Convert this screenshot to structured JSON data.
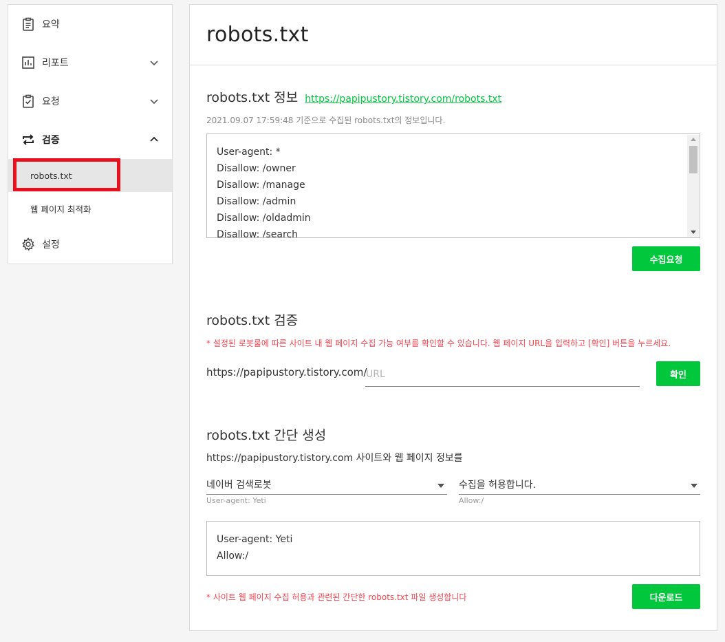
{
  "sidebar": {
    "items": [
      {
        "label": "요약",
        "icon": "clipboard-list-icon"
      },
      {
        "label": "리포트",
        "icon": "bar-chart-icon"
      },
      {
        "label": "요청",
        "icon": "clipboard-check-icon"
      },
      {
        "label": "검증",
        "icon": "swap-arrows-icon"
      },
      {
        "label": "설정",
        "icon": "gear-icon"
      }
    ],
    "sub_items": [
      {
        "label": "robots.txt",
        "active": true
      },
      {
        "label": "웹 페이지 최적화",
        "active": false
      }
    ]
  },
  "main": {
    "title": "robots.txt",
    "info_section": {
      "title": "robots.txt 정보",
      "link": "https://papipustory.tistory.com/robots.txt",
      "desc": "2021.09.07 17:59:48 기준으로 수집된 robots.txt의 정보입니다.",
      "lines": [
        "User-agent: *",
        "Disallow: /owner",
        "Disallow: /manage",
        "Disallow: /admin",
        "Disallow: /oldadmin",
        "Disallow: /search"
      ],
      "button": "수집요청"
    },
    "verify_section": {
      "title": "robots.txt 검증",
      "warning": "* 설정된 로봇룰에 따른 사이트 내 웹 페이지 수집 가능 여부를 확인할 수 있습니다. 웹 페이지 URL을 입력하고 [확인] 버튼을 누르세요.",
      "base_url": "https://papipustory.tistory.com/",
      "placeholder": "URL",
      "button": "확인"
    },
    "generate_section": {
      "title": "robots.txt 간단 생성",
      "desc": "https://papipustory.tistory.com 사이트와 웹 페이지 정보를",
      "robot_select": "네이버 검색로봇",
      "robot_help": "User-agent: Yeti",
      "allow_select": "수집을 허용합니다.",
      "allow_help": "Allow:/",
      "output_lines": [
        "User-agent: Yeti",
        "Allow:/"
      ],
      "warning": "* 사이트 웹 페이지 수집 허용과 관련된 간단한 robots.txt 파일 생성합니다",
      "button": "다운로드"
    }
  },
  "colors": {
    "accent": "#00c73c",
    "warning": "#f5444f",
    "highlight_box": "#e8101c"
  }
}
